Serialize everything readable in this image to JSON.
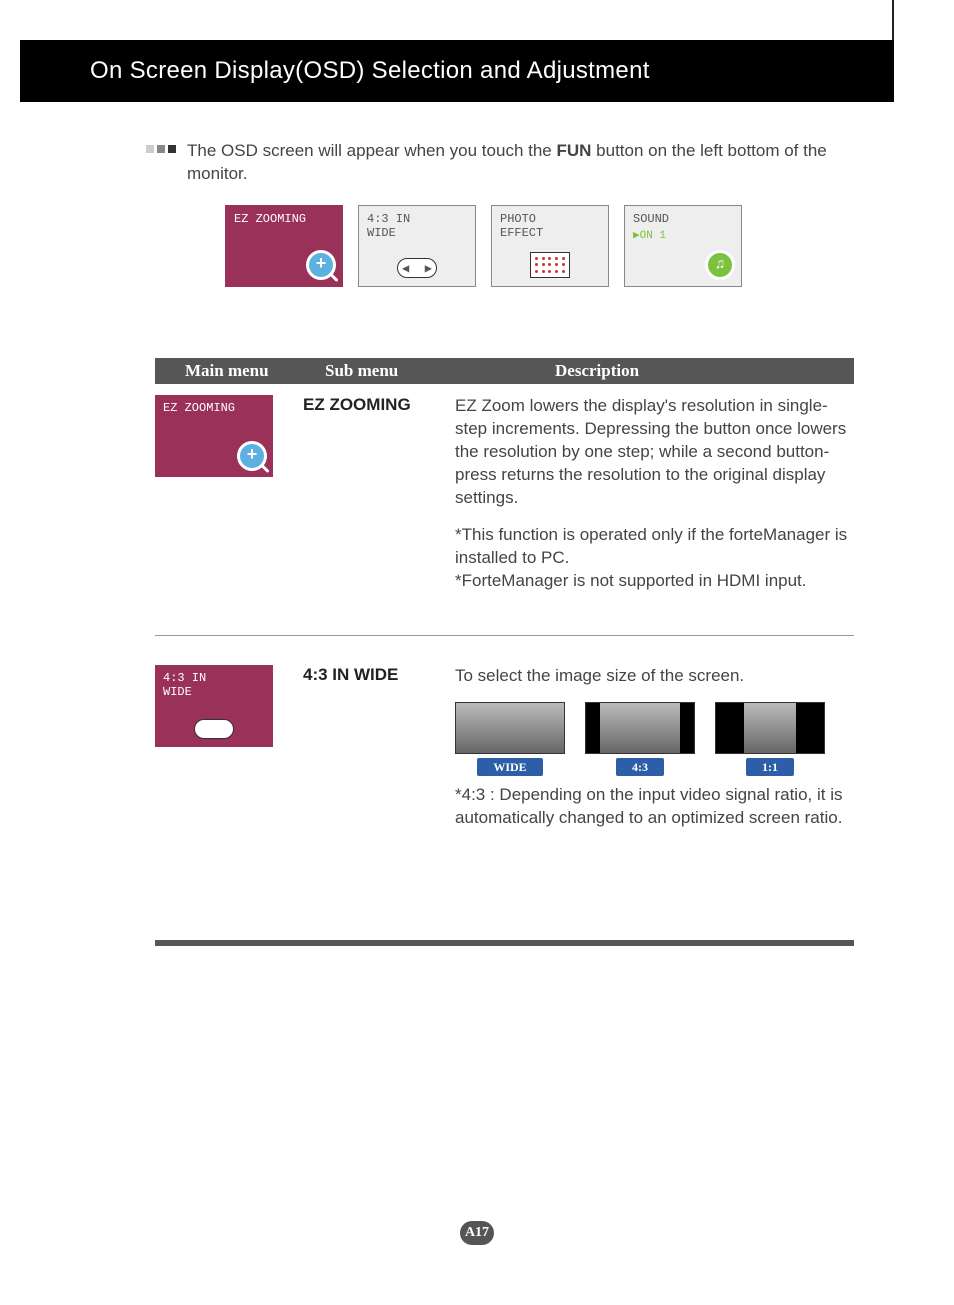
{
  "header": {
    "title": "On Screen Display(OSD) Selection and Adjustment"
  },
  "intro": {
    "text_before": "The OSD screen will appear when you touch the ",
    "bold": "FUN",
    "text_after": " button on the left bottom of the monitor."
  },
  "tiles": {
    "ez": "EZ ZOOMING",
    "wide_l1": "4:3  IN",
    "wide_l2": "WIDE",
    "photo_l1": "PHOTO",
    "photo_l2": "EFFECT",
    "sound": "SOUND",
    "sound_sub": "▶ON 1"
  },
  "table_head": {
    "main": "Main menu",
    "sub": "Sub menu",
    "desc": "Description"
  },
  "row1": {
    "tile_label": "EZ ZOOMING",
    "sub": "EZ ZOOMING",
    "p1": "EZ Zoom lowers the display's resolution in single-step increments. Depressing the button once lowers the resolution by one step; while a second button-press returns the resolution to the original display settings.",
    "p2": "*This function is operated only if the forteManager is installed to PC.",
    "p3": "*ForteManager is not supported in HDMI input."
  },
  "row2": {
    "tile_l1": "4:3  IN",
    "tile_l2": "WIDE",
    "sub": "4:3 IN WIDE",
    "p1": "To select the image size of the screen.",
    "aspects": {
      "wide": "WIDE",
      "r43": "4:3",
      "r11": "1:1"
    },
    "p2": "*4:3 : Depending on the input video signal ratio, it is automatically changed to an optimized screen ratio."
  },
  "page": "A17"
}
